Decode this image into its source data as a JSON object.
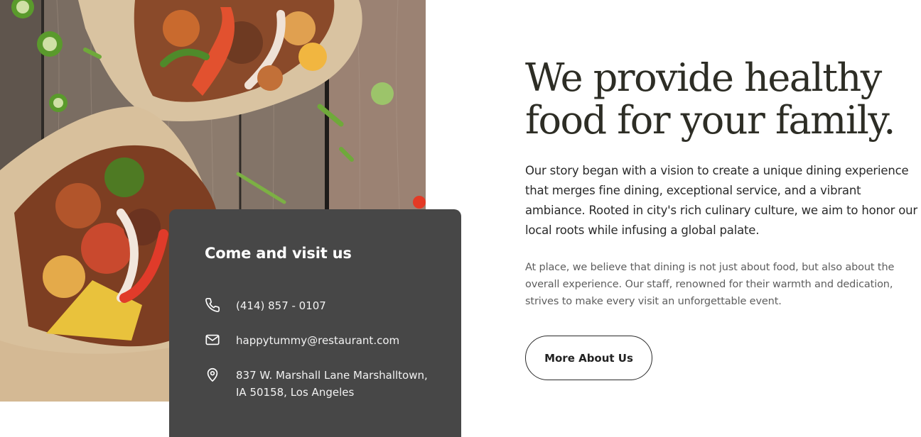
{
  "hero_image": {
    "alt": "Tortilla wraps filled with grilled meat, peppers and vegetables on a rustic wooden table"
  },
  "visit": {
    "title": "Come and visit us",
    "phone": "(414) 857 - 0107",
    "email": "happytummy@restaurant.com",
    "address_line1": "837 W. Marshall Lane Marshalltown,",
    "address_line2": "IA 50158, Los Angeles",
    "icons": {
      "phone": "phone-icon",
      "email": "mail-icon",
      "address": "location-pin-icon"
    }
  },
  "about": {
    "headline_line1": "We provide healthy",
    "headline_line2": "food for your family.",
    "intro": "Our story began with a vision to create a unique dining experience that merges fine dining, exceptional service, and a vibrant ambiance. Rooted in city's rich culinary culture, we aim to honor our local roots while infusing a global palate.",
    "detail": "At place, we believe that dining is not just about food, but also about the overall experience. Our staff, renowned for their warmth and dedication, strives to make every visit an unforgettable event.",
    "button_label": "More About Us"
  },
  "colors": {
    "card_background": "#474747",
    "headline": "#2d2d25",
    "body_text": "#2a2a2a",
    "muted_text": "#5e5e5e"
  }
}
